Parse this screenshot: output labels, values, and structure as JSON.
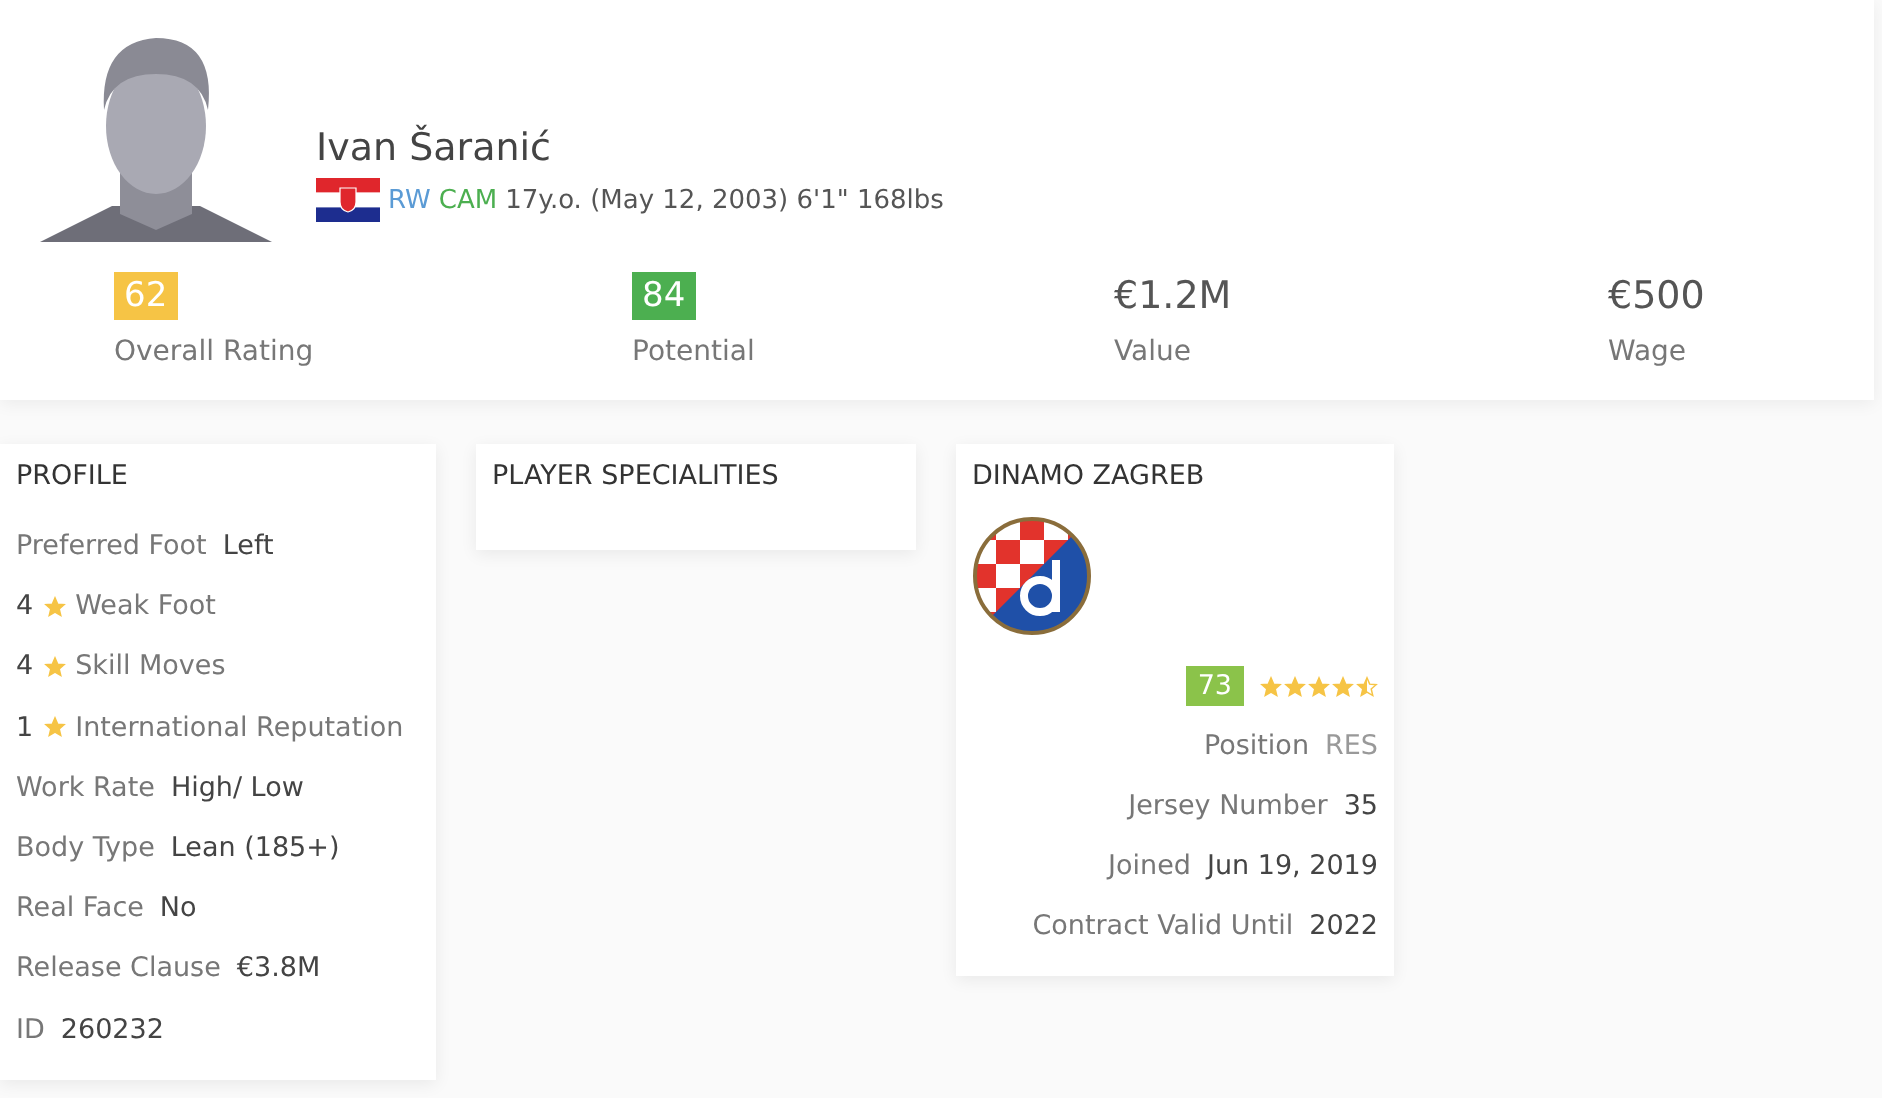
{
  "player": {
    "name": "Ivan Šaranić",
    "positions": [
      {
        "label": "RW",
        "color": "#5b9bd5"
      },
      {
        "label": "CAM",
        "color": "#4caf50"
      }
    ],
    "details": "17y.o. (May 12, 2003) 6'1\" 168lbs"
  },
  "stats": [
    {
      "kind": "badge",
      "value": "62",
      "label": "Overall Rating",
      "color": "#f6c445"
    },
    {
      "kind": "badge",
      "value": "84",
      "label": "Potential",
      "color": "#4caf50"
    },
    {
      "kind": "plain",
      "value": "€1.2M",
      "label": "Value"
    },
    {
      "kind": "plain",
      "value": "€500",
      "label": "Wage"
    }
  ],
  "profile": {
    "title": "PROFILE",
    "rows": [
      {
        "kind": "pair",
        "label": "Preferred Foot",
        "value": "Left"
      },
      {
        "kind": "star",
        "value": "4",
        "label": "Weak Foot"
      },
      {
        "kind": "star",
        "value": "4",
        "label": "Skill Moves"
      },
      {
        "kind": "star",
        "value": "1",
        "label": "International Reputation"
      },
      {
        "kind": "pair",
        "label": "Work Rate",
        "value": "High/ Low"
      },
      {
        "kind": "pair",
        "label": "Body Type",
        "value": "Lean (185+)"
      },
      {
        "kind": "pair",
        "label": "Real Face",
        "value": "No"
      },
      {
        "kind": "pair",
        "label": "Release Clause",
        "value": "€3.8M"
      },
      {
        "kind": "pair",
        "label": "ID",
        "value": "260232"
      }
    ]
  },
  "specialities": {
    "title": "PLAYER SPECIALITIES"
  },
  "club": {
    "title": "DINAMO ZAGREB",
    "rating": {
      "value": "73",
      "color": "#8bc34a"
    },
    "stars": 4.5,
    "rows": [
      {
        "label": "Position",
        "value": "RES",
        "muted": true
      },
      {
        "label": "Jersey Number",
        "value": "35",
        "muted": false
      },
      {
        "label": "Joined",
        "value": "Jun 19, 2019",
        "muted": false
      },
      {
        "label": "Contract Valid Until",
        "value": "2022",
        "muted": false
      }
    ]
  }
}
